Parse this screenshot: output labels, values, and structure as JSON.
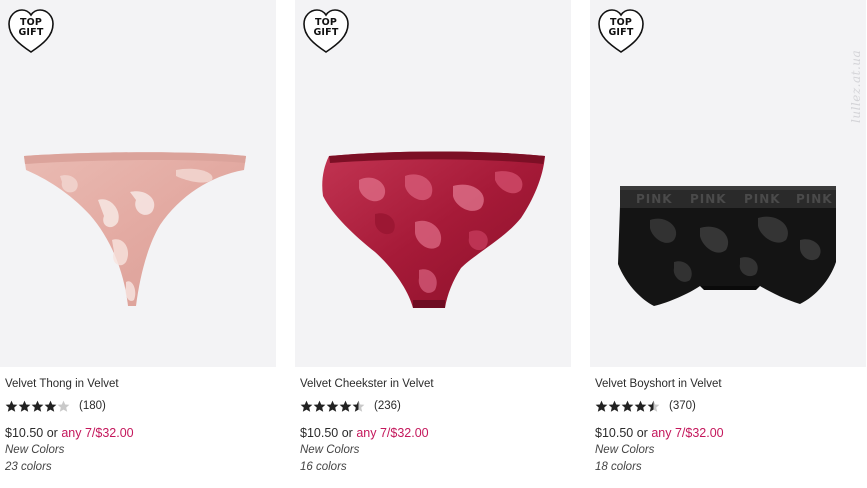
{
  "badge": {
    "line1": "TOP",
    "line2": "GIFT"
  },
  "watermark": "lullez.at.ua",
  "icons": {
    "badge": "heart-outline-icon",
    "rating": "star-icon"
  },
  "colors": {
    "tile_background": "#f3f3f5",
    "deal_accent": "#c4185c",
    "star_fill": "#222222",
    "star_empty": "#c9c9c9"
  },
  "products": [
    {
      "name": "Velvet Thong in Velvet",
      "rating": 4,
      "review_count": "(180)",
      "price": "$10.50",
      "or_text": "or",
      "deal": "any 7/$32.00",
      "note1": "New Colors",
      "note2": "23 colors",
      "swatch": "#e8b3ad"
    },
    {
      "name": "Velvet Cheekster in Velvet",
      "rating": 4.5,
      "review_count": "(236)",
      "price": "$10.50",
      "or_text": "or",
      "deal": "any 7/$32.00",
      "note1": "New Colors",
      "note2": "16 colors",
      "swatch": "#b0203f"
    },
    {
      "name": "Velvet Boyshort in Velvet",
      "rating": 4.5,
      "review_count": "(370)",
      "price": "$10.50",
      "or_text": "or",
      "deal": "any 7/$32.00",
      "note1": "New Colors",
      "note2": "18 colors",
      "swatch": "#151515"
    }
  ]
}
